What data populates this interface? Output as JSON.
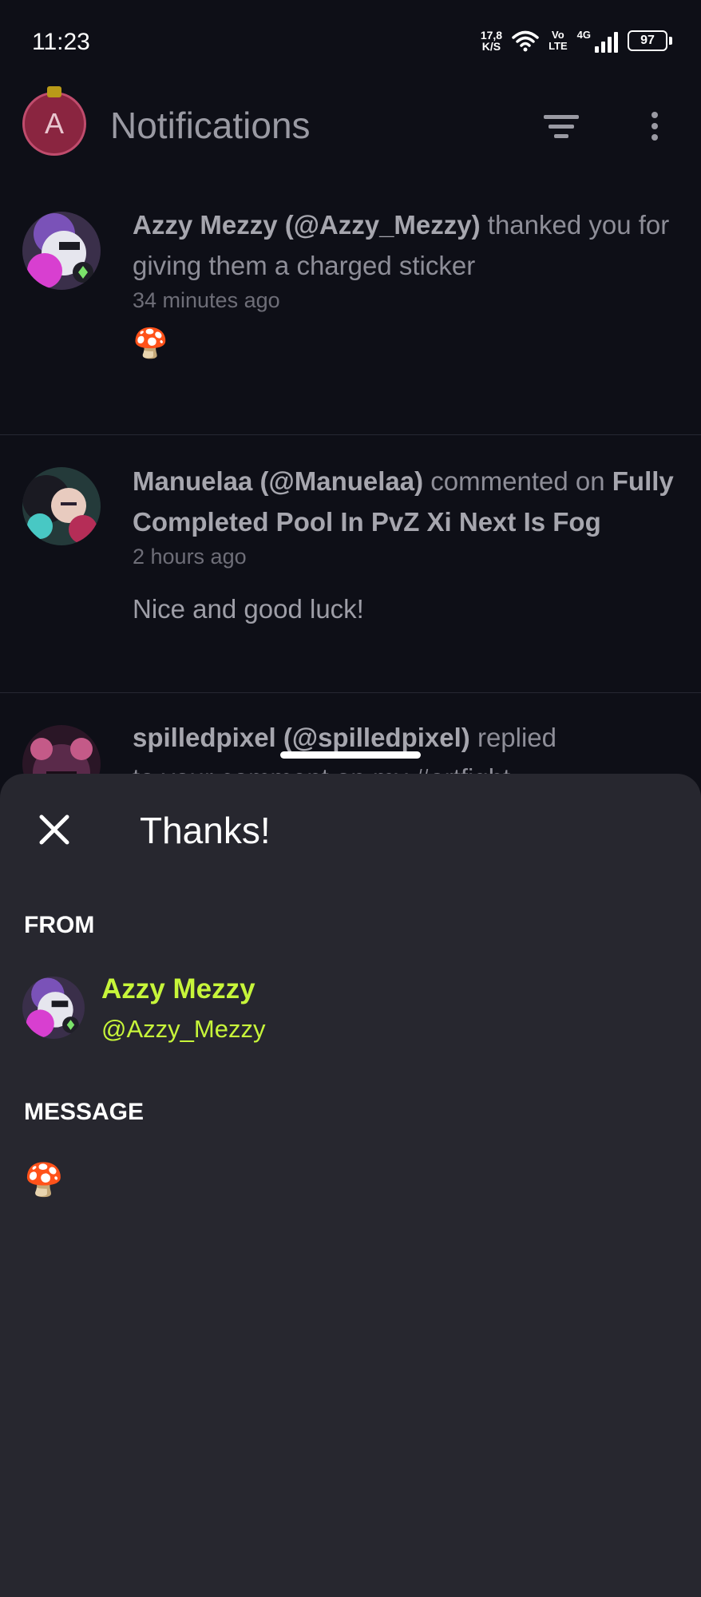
{
  "status_bar": {
    "time": "11:23",
    "net_speed_value": "17,8",
    "net_speed_unit": "K/S",
    "volte_top": "Vo",
    "volte_bottom": "LTE",
    "network": "4G",
    "battery": "97"
  },
  "header": {
    "avatar_letter": "A",
    "title": "Notifications"
  },
  "notifications": [
    {
      "actor": "Azzy Mezzy (@Azzy_Mezzy)",
      "action": "thanked you for giving them a charged sticker",
      "time": "34 minutes ago",
      "content": "🍄"
    },
    {
      "actor": "Manuelaa (@Manuelaa)",
      "action": "commented on",
      "target": "Fully Completed Pool In PvZ Xi Next Is Fog",
      "time": "2 hours ago",
      "content": "Nice and good luck!"
    },
    {
      "actor": "spilledpixel (@spilledpixel)",
      "action": "replied",
      "action_cont": "to your comment on my #artfight"
    }
  ],
  "sheet": {
    "title": "Thanks!",
    "from_label": "FROM",
    "from_name": "Azzy Mezzy",
    "from_handle": "@Azzy_Mezzy",
    "message_label": "MESSAGE",
    "message": "🍄"
  },
  "colors": {
    "background": "#0e0f17",
    "sheet": "#27272f",
    "accent": "#c7f53a",
    "avatar_a": "#8a2540"
  },
  "icons": [
    "filter-icon",
    "more-vertical-icon",
    "close-icon",
    "wifi-icon",
    "signal-icon",
    "battery-icon",
    "mushroom-emoji"
  ]
}
